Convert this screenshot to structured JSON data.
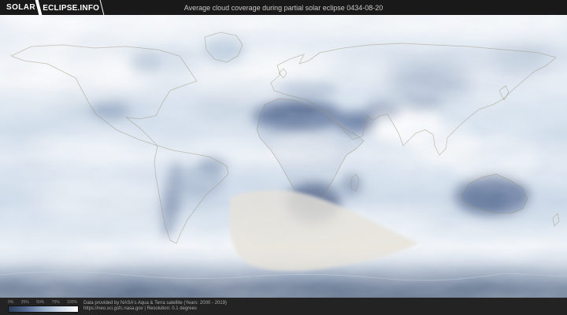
{
  "header": {
    "logo": {
      "primary": "SOLAR",
      "secondary": "ECLIPSE.INFO"
    },
    "title": "Average cloud coverage during partial solar eclipse 0434-08-20"
  },
  "legend": {
    "ticks": [
      "0%",
      "25%",
      "50%",
      "75%",
      "100%"
    ],
    "gradient_stops": [
      "#2e3e5a",
      "#546a92",
      "#93a9c7",
      "#cdd9e8",
      "#ffffff"
    ]
  },
  "footer": {
    "attribution_line1": "Data provided by NASA's Aqua & Terra satellite (Years: 2000 - 2019)",
    "attribution_line2": "https://neo.sci.gsfc.nasa.gov | Resolution: 0.1 degrees"
  },
  "colors": {
    "header_bg": "#191919",
    "footer_bg": "#232323",
    "clear_sky": "#46597f",
    "cloudy_sky": "#ffffff",
    "map_base": "#dce6f1",
    "eclipse_overlay": "#e6e2d9"
  }
}
